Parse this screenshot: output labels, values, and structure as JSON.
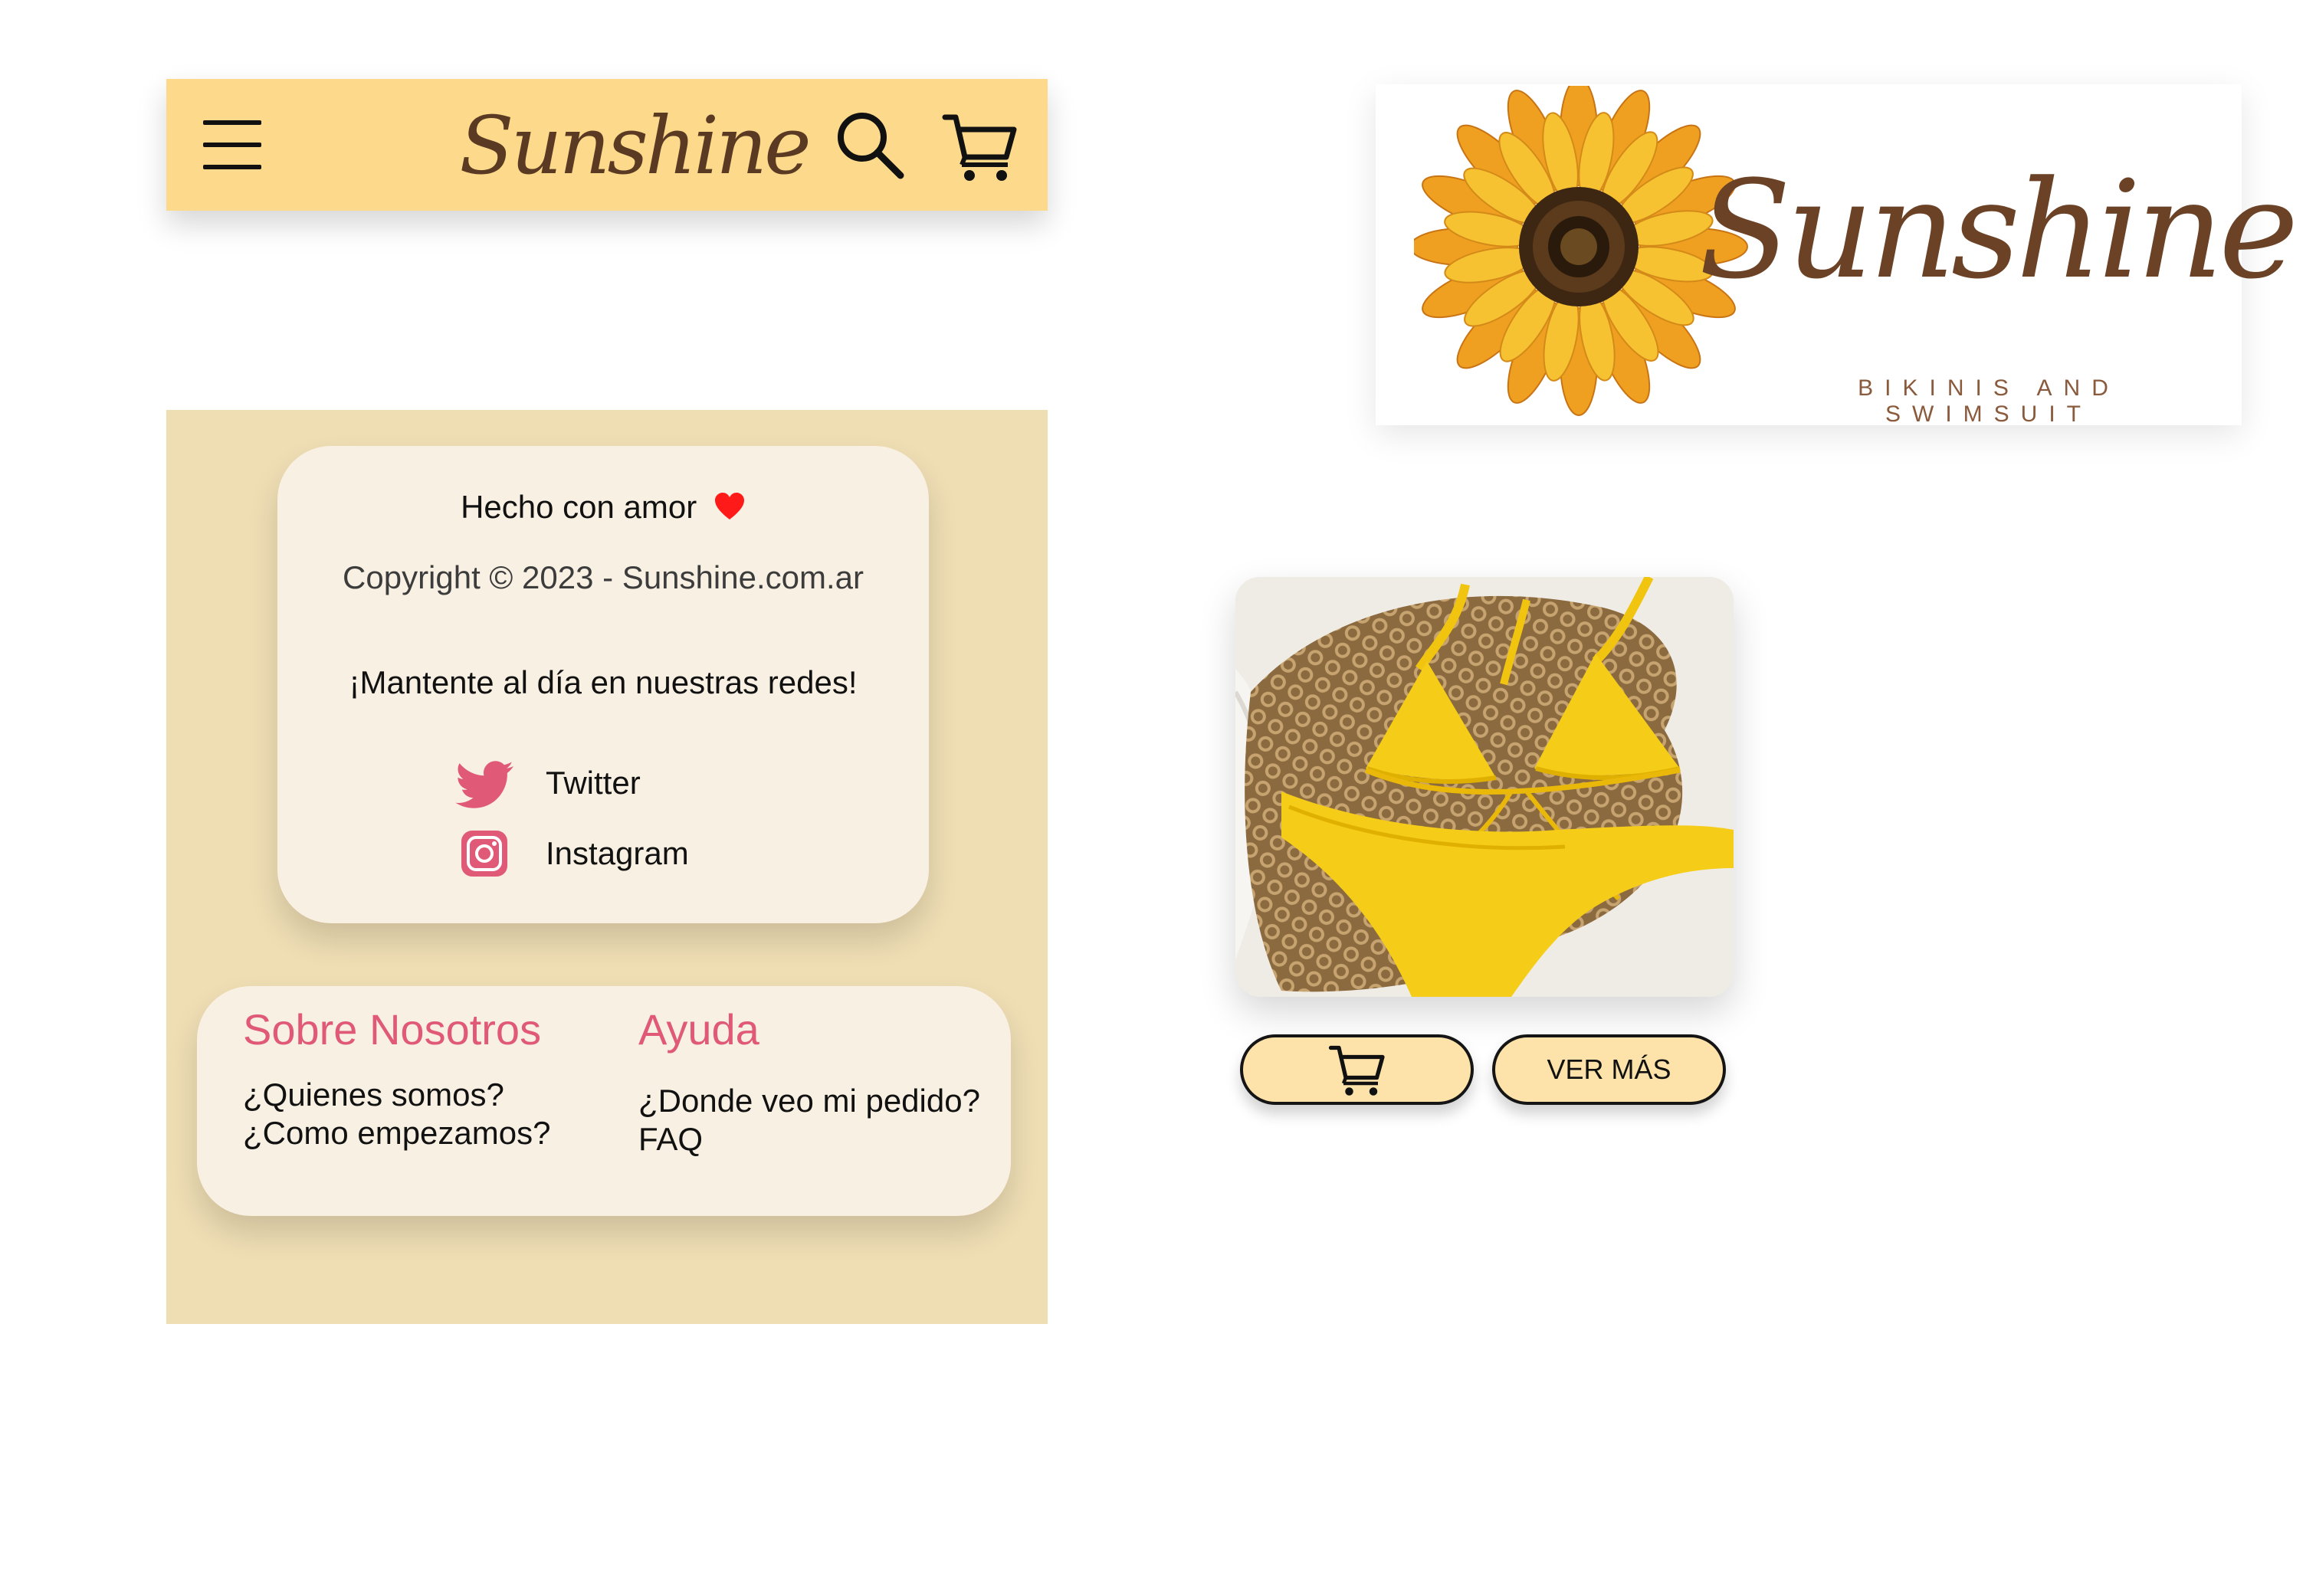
{
  "header": {
    "logo_text": "Sunshine",
    "icons": [
      "menu-icon",
      "search-icon",
      "cart-icon"
    ]
  },
  "brand_logo": {
    "name": "Sunshine",
    "tagline": "BIKINIS AND SWIMSUIT"
  },
  "footer": {
    "made_with": "Hecho con amor",
    "copyright": "Copyright © 2023 - Sunshine.com.ar",
    "stay_tuned": "¡Mantente al día en nuestras redes!",
    "social": [
      {
        "label": "Twitter",
        "icon": "twitter-icon"
      },
      {
        "label": "Instagram",
        "icon": "instagram-icon"
      }
    ],
    "columns": [
      {
        "heading": "Sobre Nosotros",
        "links": [
          "¿Quienes somos?",
          "¿Como empezamos?"
        ]
      },
      {
        "heading": "Ayuda",
        "links": [
          "¿Donde veo mi pedido?",
          "FAQ"
        ]
      }
    ]
  },
  "product": {
    "image": "yellow-bikini-photo",
    "view_more_label": "VER MÁS"
  },
  "colors": {
    "header_bg": "#fdda8b",
    "footer_bg": "#efdeb4",
    "card_bg": "#f8f0e2",
    "accent_pink": "#e05a78",
    "logo_brown": "#6b4226",
    "button_bg": "#fde3a9",
    "heart": "#ff1a1a"
  }
}
